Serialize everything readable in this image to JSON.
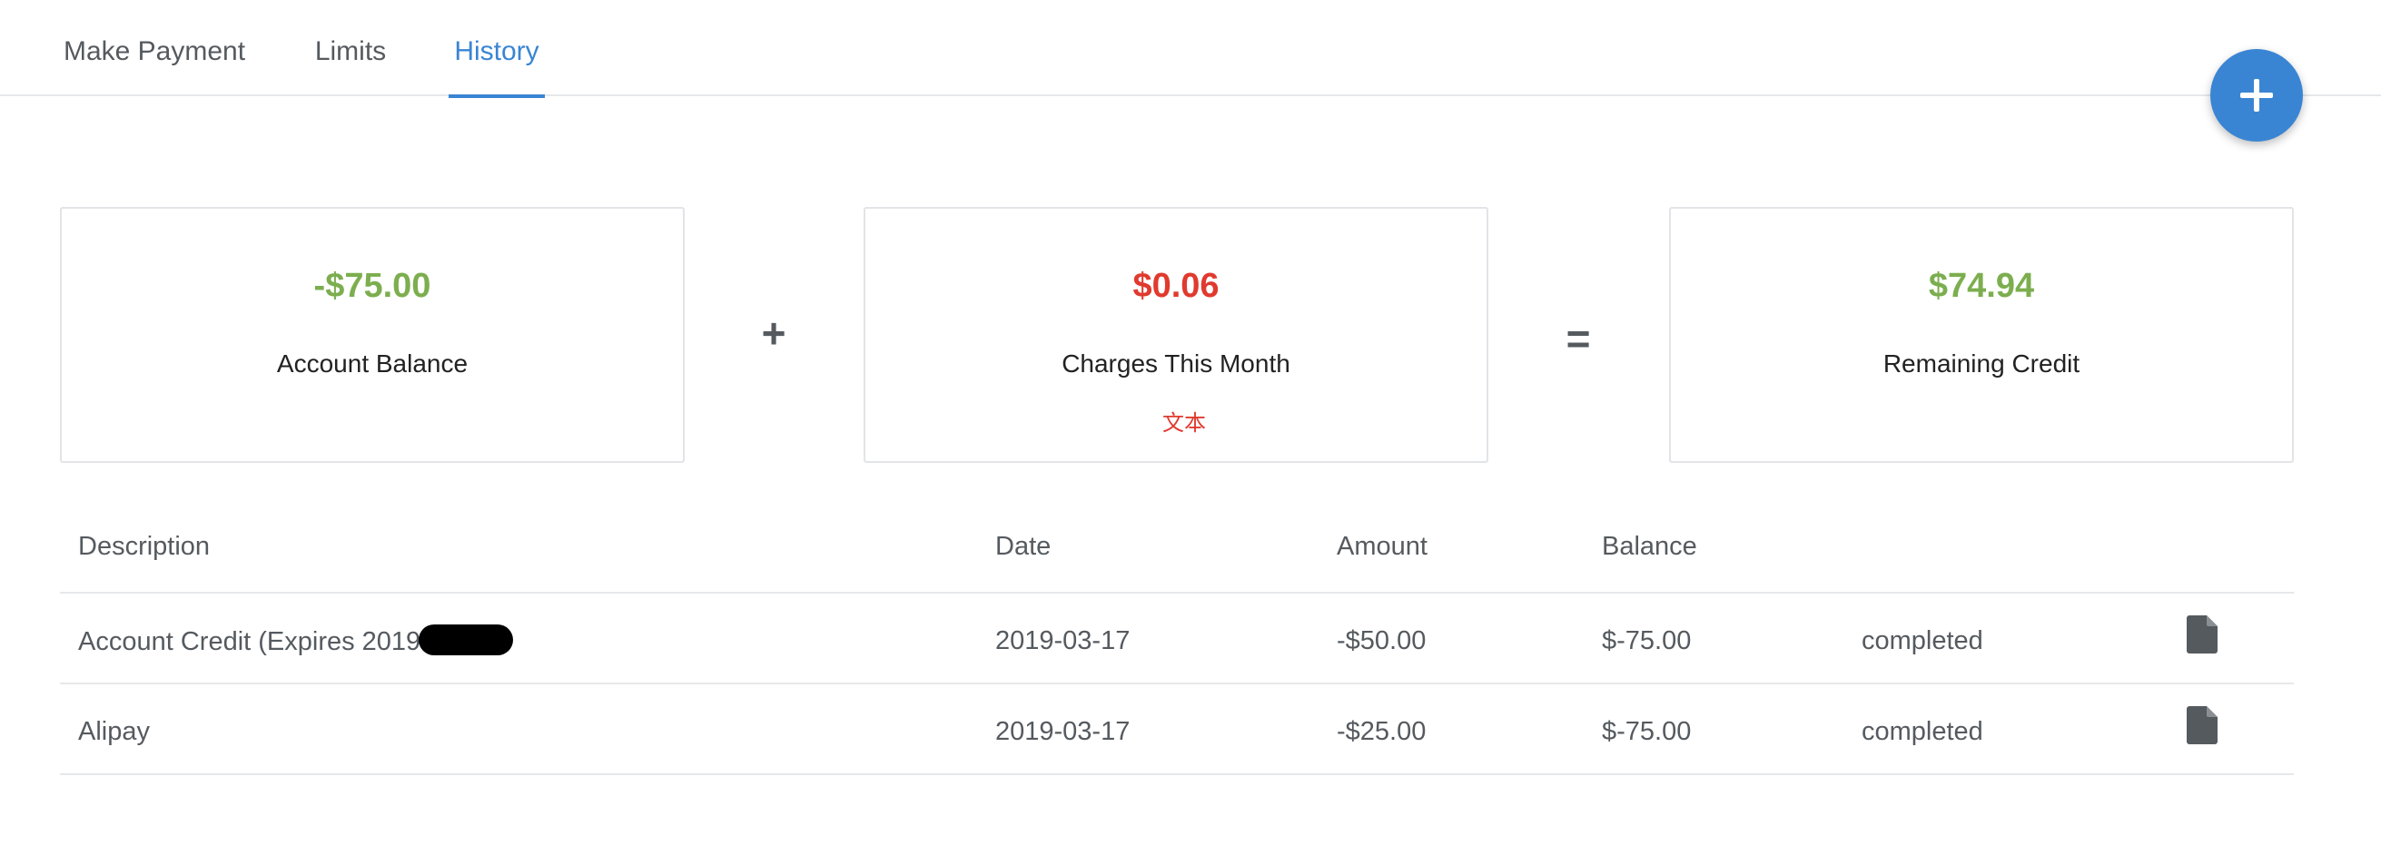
{
  "tabs": [
    {
      "label": "Make Payment",
      "active": false
    },
    {
      "label": "Limits",
      "active": false
    },
    {
      "label": "History",
      "active": true
    }
  ],
  "fab": {
    "icon": "plus-icon",
    "color": "#3a85d3"
  },
  "summary": {
    "balance": {
      "amount": "-$75.00",
      "label": "Account Balance",
      "color": "#7cae4f"
    },
    "operator_plus": "+",
    "charges": {
      "amount": "$0.06",
      "label": "Charges This Month",
      "note": "文本",
      "color": "#e03a2f"
    },
    "operator_equals": "=",
    "remaining": {
      "amount": "$74.94",
      "label": "Remaining Credit",
      "color": "#7cae4f"
    }
  },
  "table": {
    "headers": {
      "description": "Description",
      "date": "Date",
      "amount": "Amount",
      "balance": "Balance"
    },
    "rows": [
      {
        "description": "Account Credit (Expires 2019",
        "redacted": true,
        "date": "2019-03-17",
        "amount": "-$50.00",
        "balance": "$-75.00",
        "status": "completed",
        "icon": "document-icon"
      },
      {
        "description": "Alipay",
        "redacted": false,
        "date": "2019-03-17",
        "amount": "-$25.00",
        "balance": "$-75.00",
        "status": "completed",
        "icon": "document-icon"
      }
    ]
  },
  "colors": {
    "accent": "#3a85d3",
    "positive": "#7cae4f",
    "negative": "#e03a2f",
    "text": "#555a5f"
  }
}
